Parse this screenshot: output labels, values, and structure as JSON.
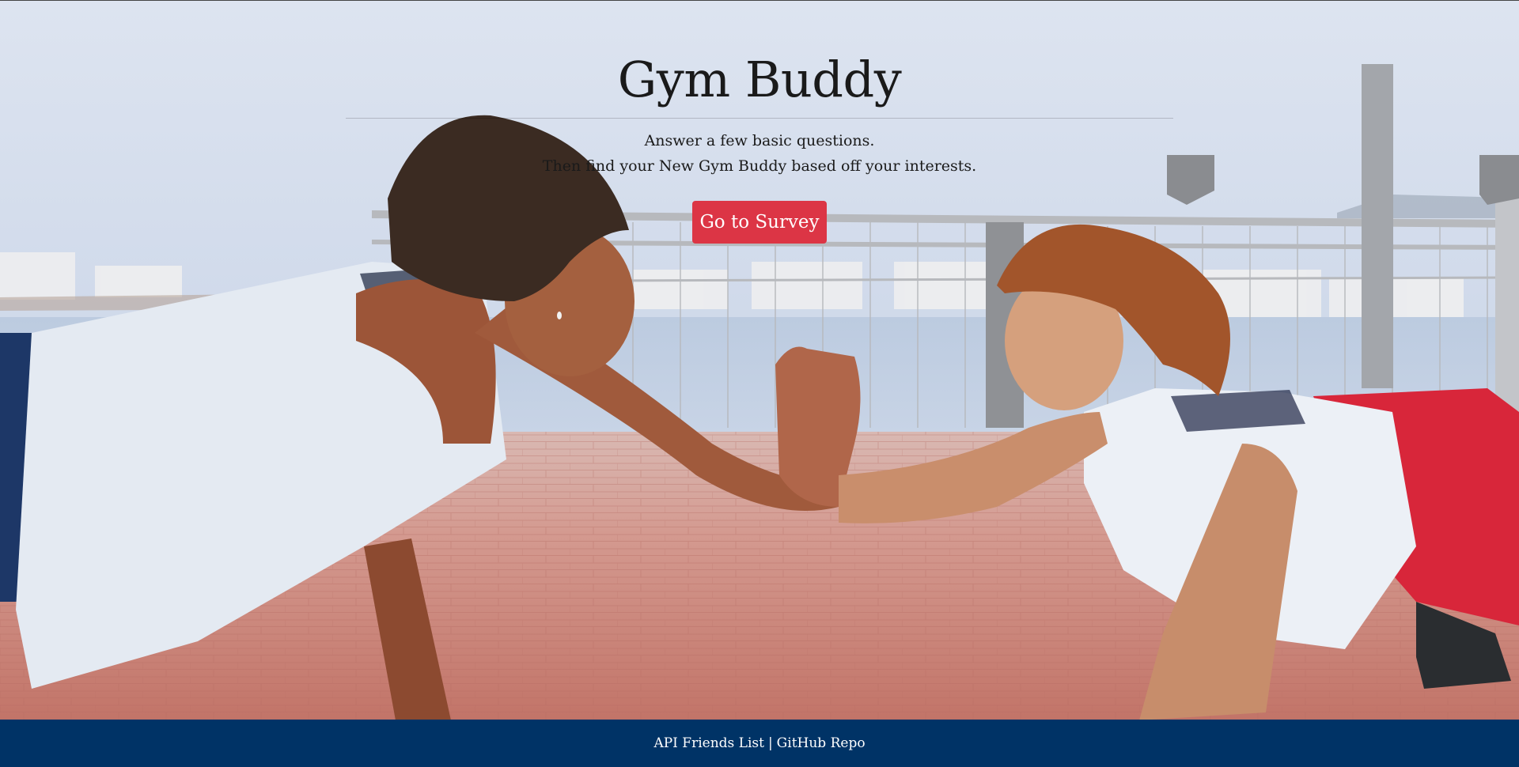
{
  "hero": {
    "title": "Gym Buddy",
    "lead_line_1": "Answer a few basic questions.",
    "lead_line_2": "Then find your New Gym Buddy based off your interests.",
    "survey_button": "Go to Survey"
  },
  "footer": {
    "api_link": "API Friends List",
    "separator": "|",
    "github_link": "GitHub Repo"
  },
  "colors": {
    "button": "#dc3545",
    "footer_bg": "#003366"
  }
}
